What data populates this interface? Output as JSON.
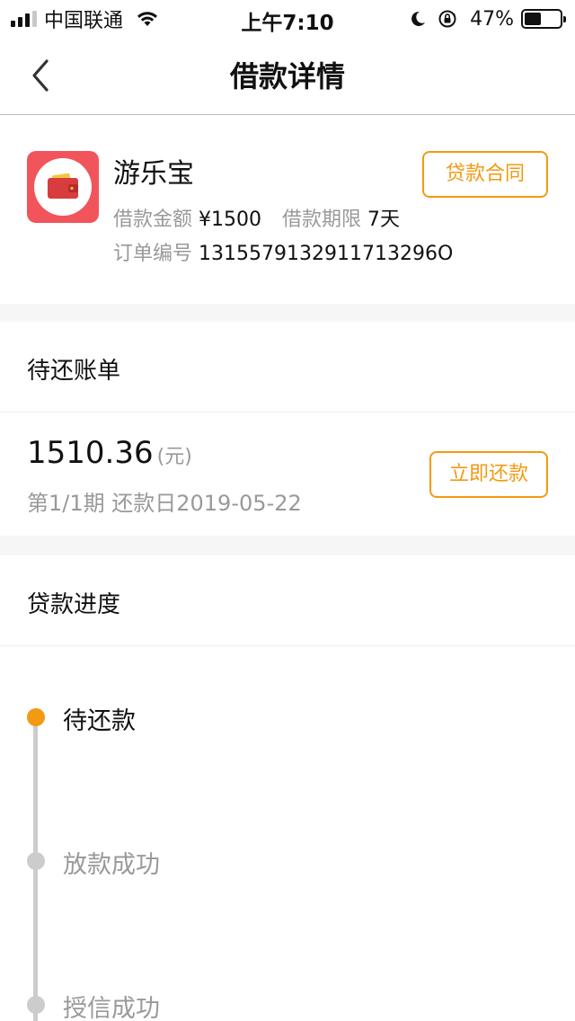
{
  "status_bar": {
    "carrier": "中国联通",
    "time": "上午7:10",
    "battery": "47%",
    "battery_level": 0.47,
    "icons": [
      "signal-icon",
      "wifi-icon",
      "moon-icon",
      "rotation-lock-icon",
      "battery-icon"
    ]
  },
  "nav": {
    "title": "借款详情",
    "back_icon": "chevron-left-icon"
  },
  "loan": {
    "app_name": "游乐宝",
    "logo_icon": "wallet-icon",
    "amount_label": "借款金额",
    "amount_value": "¥1500",
    "term_label": "借款期限",
    "term_value": "7天",
    "order_label": "订单编号",
    "order_value": "1315579132911713296O",
    "contract_button": "贷款合同"
  },
  "bill": {
    "section_title": "待还账单",
    "amount": "1510.36",
    "unit": "(元)",
    "due_info": "第1/1期 还款日2019-05-22",
    "repay_button": "立即还款"
  },
  "progress": {
    "section_title": "贷款进度",
    "steps": [
      {
        "label": "待还款",
        "active": true
      },
      {
        "label": "放款成功",
        "active": false
      },
      {
        "label": "授信成功",
        "active": false
      }
    ]
  },
  "colors": {
    "accent": "#f29a12",
    "logo_bg": "#f1545a",
    "inactive": "#cccccc",
    "muted_text": "#999999"
  }
}
